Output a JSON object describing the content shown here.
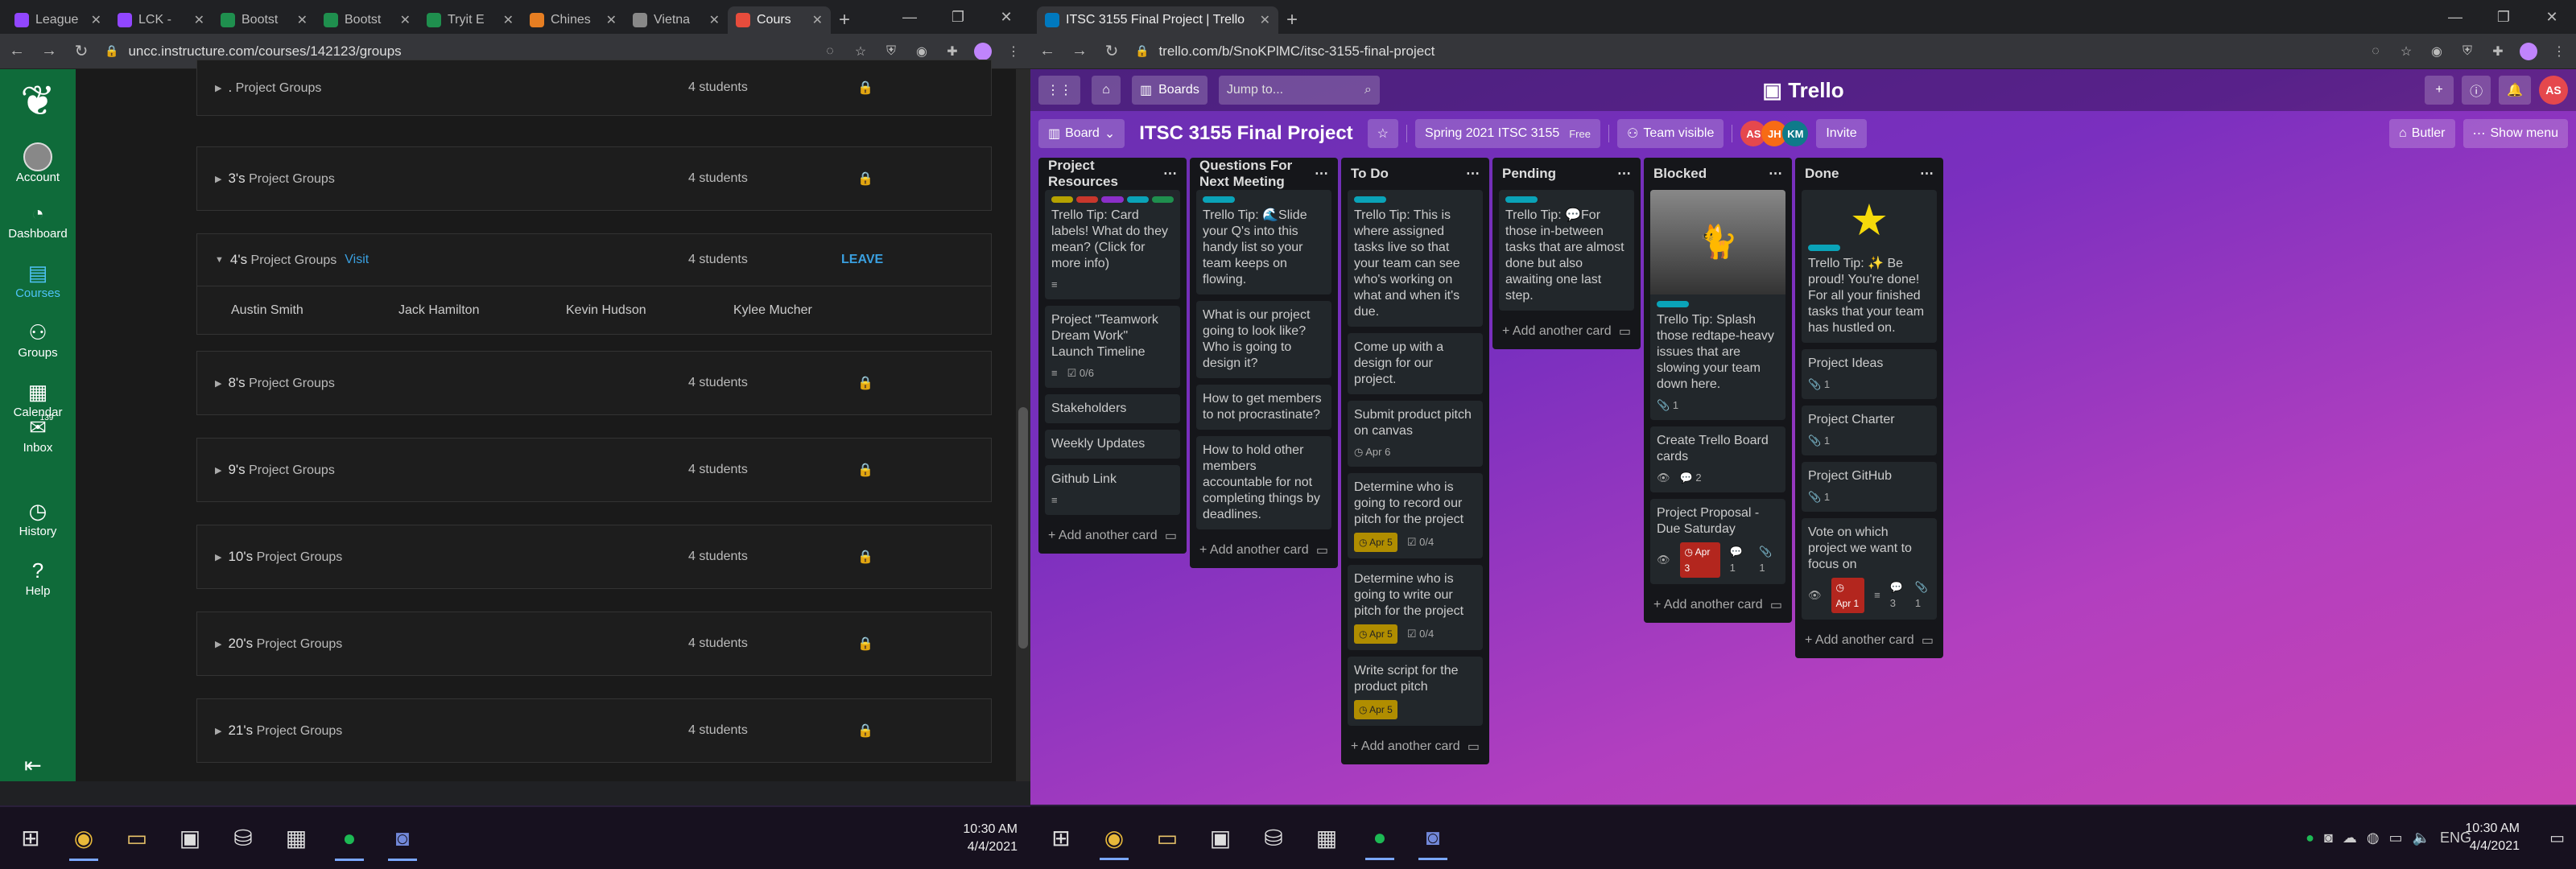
{
  "left_browser": {
    "tabs": [
      {
        "label": "League",
        "color": "#9146ff"
      },
      {
        "label": "LCK -",
        "color": "#9146ff"
      },
      {
        "label": "Bootst",
        "color": "#1f8f4e"
      },
      {
        "label": "Bootst",
        "color": "#1f8f4e"
      },
      {
        "label": "Tryit E",
        "color": "#1f8f4e"
      },
      {
        "label": "Chines",
        "color": "#e67e22"
      },
      {
        "label": "Vietna",
        "color": "#888888"
      },
      {
        "label": "Cours",
        "color": "#e74c3c",
        "active": true
      }
    ],
    "url": "uncc.instructure.com/courses/142123/groups"
  },
  "canvas": {
    "nav": [
      {
        "label": "Account",
        "icon": "avatar"
      },
      {
        "label": "Dashboard",
        "icon": "dashboard-icon",
        "glyph": "◔"
      },
      {
        "label": "Courses",
        "icon": "book-icon",
        "glyph": "▤",
        "active": true
      },
      {
        "label": "Groups",
        "icon": "people-icon",
        "glyph": "⚇"
      },
      {
        "label": "Calendar",
        "icon": "calendar-icon",
        "glyph": "▦"
      },
      {
        "label": "Inbox",
        "icon": "inbox-icon",
        "glyph": "✉",
        "badge": "139"
      },
      {
        "label": "History",
        "icon": "clock-icon",
        "glyph": "◷"
      },
      {
        "label": "Help",
        "icon": "help-icon",
        "glyph": "?"
      }
    ],
    "groups": [
      {
        "name": ".",
        "suffix": " Project Groups",
        "count": "4 students"
      },
      {
        "name": "3's",
        "suffix": " Project Groups",
        "count": "4 students"
      },
      {
        "name": "4's",
        "suffix": " Project Groups",
        "count": "4 students",
        "visit": "Visit",
        "leave": "LEAVE",
        "expanded": true
      },
      {
        "name": "8's",
        "suffix": " Project Groups",
        "count": "4 students"
      },
      {
        "name": "9's",
        "suffix": " Project Groups",
        "count": "4 students"
      },
      {
        "name": "10's",
        "suffix": " Project Groups",
        "count": "4 students"
      },
      {
        "name": "20's",
        "suffix": " Project Groups",
        "count": "4 students"
      },
      {
        "name": "21's",
        "suffix": " Project Groups",
        "count": "4 students"
      }
    ],
    "members": [
      "Austin Smith",
      "Jack Hamilton",
      "Kevin Hudson",
      "Kylee Mucher"
    ]
  },
  "left_taskbar": {
    "time": "10:30 AM",
    "date": "4/4/2021"
  },
  "right_browser": {
    "tab_title": "ITSC 3155 Final Project | Trello",
    "url": "trello.com/b/SnoKPlMC/itsc-3155-final-project"
  },
  "trello": {
    "boards_label": "Boards",
    "jump_placeholder": "Jump to...",
    "logo": "Trello",
    "user_initials": "AS",
    "board_menu": "Board",
    "board_title": "ITSC 3155 Final Project",
    "team": "Spring 2021 ITSC 3155",
    "free": "Free",
    "visibility": "Team visible",
    "members": [
      {
        "initials": "AS",
        "color": "#e5484d"
      },
      {
        "initials": "JH",
        "color": "#f76b15"
      },
      {
        "initials": "KM",
        "color": "#0f7a8a"
      }
    ],
    "invite": "Invite",
    "butler": "Butler",
    "show_menu": "Show menu",
    "add_card": "Add another card",
    "lists": [
      {
        "title": "Project Resources",
        "cards": [
          {
            "text": "Trello Tip: Card labels! What do they mean? (Click for more info)",
            "labels": [
              "#b5a200",
              "#c9372c",
              "#8b2fc9",
              "#0aa3b8",
              "#1f8f4e"
            ],
            "desc": true
          },
          {
            "text": "Project \"Teamwork Dream Work\" Launch Timeline",
            "desc": true,
            "checklist": "0/6"
          },
          {
            "text": "Stakeholders"
          },
          {
            "text": "Weekly Updates"
          },
          {
            "text": "Github Link",
            "desc": true
          }
        ]
      },
      {
        "title": "Questions For Next Meeting",
        "cards": [
          {
            "text": "Trello Tip: 🌊Slide your Q's into this handy list so your team keeps on flowing.",
            "labels": [
              "#0aa3b8"
            ]
          },
          {
            "text": "What is our project going to look like? Who is going to design it?"
          },
          {
            "text": "How to get members to not procrastinate?"
          },
          {
            "text": "How to hold other members accountable for not completing things by deadlines."
          }
        ]
      },
      {
        "title": "To Do",
        "cards": [
          {
            "text": "Trello Tip: This is where assigned tasks live so that your team can see who's working on what and when it's due.",
            "labels": [
              "#0aa3b8"
            ]
          },
          {
            "text": "Come up with a design for our project."
          },
          {
            "text": "Submit product pitch on canvas",
            "date": "Apr 6"
          },
          {
            "text": "Determine who is going to record our pitch for the project",
            "due": "Apr 5",
            "checklist": "0/4"
          },
          {
            "text": "Determine who is going to write our pitch for the project",
            "due": "Apr 5",
            "checklist": "0/4"
          },
          {
            "text": "Write script for the product pitch",
            "due": "Apr 5"
          }
        ]
      },
      {
        "title": "Pending",
        "cards": [
          {
            "text": "Trello Tip: 💬For those in-between tasks that are almost done but also awaiting one last step.",
            "labels": [
              "#0aa3b8"
            ]
          }
        ]
      },
      {
        "title": "Blocked",
        "cards": [
          {
            "text": "Trello Tip: Splash those redtape-heavy issues that are slowing your team down here.",
            "labels": [
              "#0aa3b8"
            ],
            "image": true,
            "attach": "1"
          },
          {
            "text": "Create Trello Board cards",
            "watch": true,
            "comments": "2"
          },
          {
            "text": "Project Proposal -Due Saturday",
            "watch": true,
            "overdue": "Apr 3",
            "comments": "1",
            "attach": "1"
          }
        ]
      },
      {
        "title": "Done",
        "cards": [
          {
            "text": "Trello Tip: ✨ Be proud! You're done! For all your finished tasks that your team has hustled on.",
            "labels": [
              "#0aa3b8"
            ],
            "star": true
          },
          {
            "text": "Project Ideas",
            "attach": "1"
          },
          {
            "text": "Project Charter",
            "attach": "1"
          },
          {
            "text": "Project GitHub",
            "attach": "1"
          },
          {
            "text": "Vote on which project we want to focus on",
            "watch": true,
            "overdue": "Apr 1",
            "desc": true,
            "comments": "3",
            "attach": "1"
          }
        ]
      }
    ]
  },
  "right_taskbar": {
    "lang": "ENG",
    "time": "10:30 AM",
    "date": "4/4/2021"
  }
}
